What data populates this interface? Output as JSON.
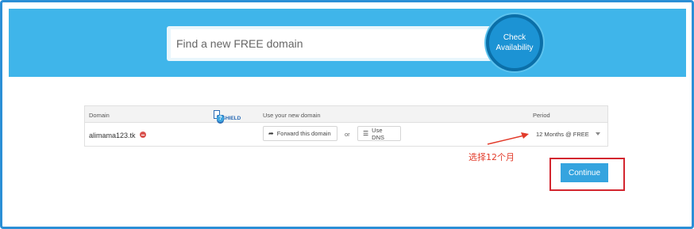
{
  "search": {
    "placeholder": "Find a new FREE domain",
    "check_line1": "Check",
    "check_line2": "Availability"
  },
  "table": {
    "headers": {
      "domain": "Domain",
      "use": "Use your new domain",
      "period": "Period"
    },
    "idshield_label": "IDSHIELD",
    "help_symbol": "?",
    "row": {
      "domain": "alimama123.tk",
      "forward_label": "Forward this domain",
      "or_label": "or",
      "dns_label": "Use DNS",
      "period_value": "12 Months @ FREE"
    }
  },
  "annotation": {
    "note": "选择12个月",
    "color": "#e23b2a"
  },
  "actions": {
    "continue_label": "Continue"
  },
  "colors": {
    "hero": "#3fb5ea",
    "accent": "#35a4df",
    "highlight_box": "#d3262f",
    "frame": "#2b8fd6"
  },
  "icons": {
    "forward": "share-arrow-icon",
    "dns": "list-icon",
    "remove": "remove-circle-icon",
    "help": "help-circle-icon",
    "caret": "chevron-down-icon"
  }
}
